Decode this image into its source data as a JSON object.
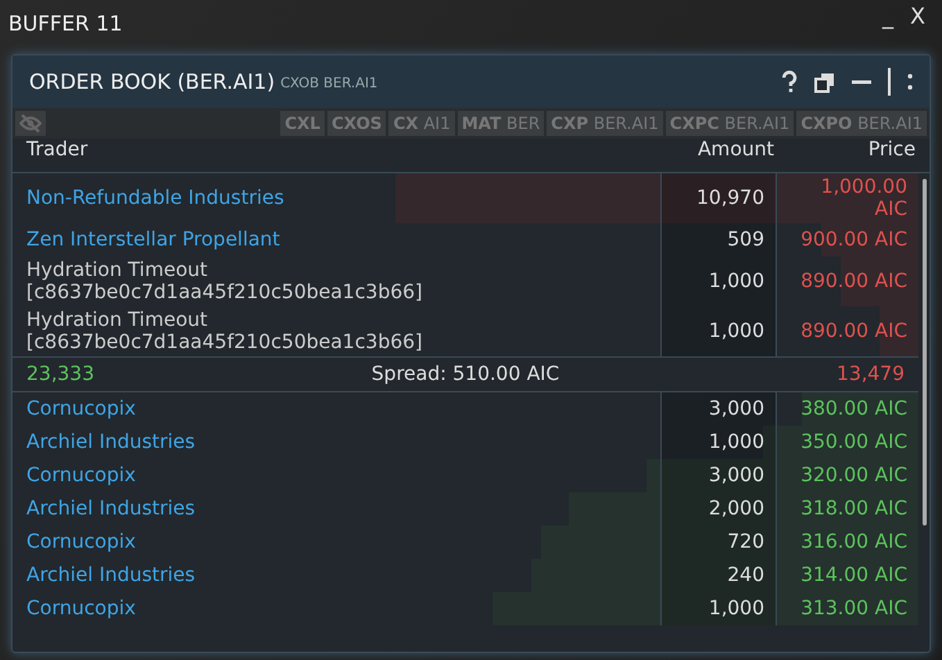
{
  "window": {
    "title": "BUFFER 11",
    "minimize": "_",
    "close": "X"
  },
  "panel": {
    "title": "ORDER BOOK (BER.AI1)",
    "command": "CXOB BER.AI1"
  },
  "toolbar": {
    "buttons": [
      {
        "code": "CXL"
      },
      {
        "code": "CXOS"
      },
      {
        "code": "CX",
        "arg": "AI1"
      },
      {
        "code": "MAT",
        "arg": "BER"
      },
      {
        "code": "CXP",
        "arg": "BER.AI1"
      },
      {
        "code": "CXPC",
        "arg": "BER.AI1"
      },
      {
        "code": "CXPO",
        "arg": "BER.AI1"
      }
    ]
  },
  "table": {
    "columns": [
      "Trader",
      "Amount",
      "Price"
    ],
    "asks": [
      {
        "trader": "Non-Refundable Industries",
        "link": true,
        "amount": "10,970",
        "price": "1,000.00 AIC"
      },
      {
        "trader": "Zen Interstellar Propellant",
        "link": true,
        "amount": "509",
        "price": "900.00 AIC"
      },
      {
        "trader": "Hydration Timeout [c8637be0c7d1aa45f210c50bea1c3b66]",
        "link": false,
        "amount": "1,000",
        "price": "890.00 AIC"
      },
      {
        "trader": "Hydration Timeout [c8637be0c7d1aa45f210c50bea1c3b66]",
        "link": false,
        "amount": "1,000",
        "price": "890.00 AIC"
      }
    ],
    "spread": {
      "bid_total": "23,333",
      "text": "Spread: 510.00 AIC",
      "ask_total": "13,479"
    },
    "bids": [
      {
        "trader": "Cornucopix",
        "link": true,
        "amount": "3,000",
        "price": "380.00 AIC"
      },
      {
        "trader": "Archiel Industries",
        "link": true,
        "amount": "1,000",
        "price": "350.00 AIC"
      },
      {
        "trader": "Cornucopix",
        "link": true,
        "amount": "3,000",
        "price": "320.00 AIC"
      },
      {
        "trader": "Archiel Industries",
        "link": true,
        "amount": "2,000",
        "price": "318.00 AIC"
      },
      {
        "trader": "Cornucopix",
        "link": true,
        "amount": "720",
        "price": "316.00 AIC"
      },
      {
        "trader": "Archiel Industries",
        "link": true,
        "amount": "240",
        "price": "314.00 AIC"
      },
      {
        "trader": "Cornucopix",
        "link": true,
        "amount": "1,000",
        "price": "313.00 AIC"
      }
    ]
  }
}
